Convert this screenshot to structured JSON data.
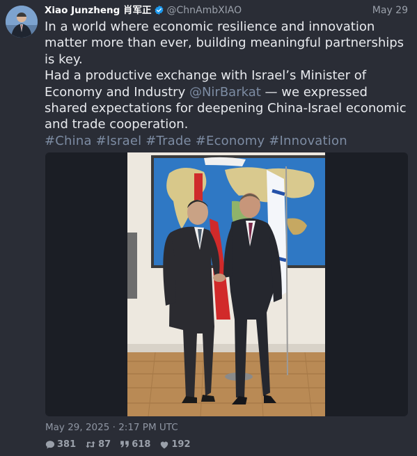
{
  "author": {
    "display_name": "Xiao Junzheng 肖军正",
    "handle": "@ChnAmbXIAO",
    "verified_icon": "verified-badge-icon"
  },
  "post": {
    "date_short": "May 29",
    "text_line1": "In a world where economic resilience and innovation matter more than ever, building meaningful partnerships is key.",
    "text_line2_before": "Had a productive exchange with Israel’s Minister of Economy and Industry ",
    "mention": "@NirBarkat",
    "text_line2_after": " — we expressed shared expectations for deepening China-Israel economic and trade cooperation.",
    "hashtags": [
      "#China",
      "#Israel",
      "#Trade",
      "#Economy",
      "#Innovation"
    ],
    "timestamp": "May 29, 2025 · 2:17 PM UTC"
  },
  "stats": {
    "replies": "381",
    "retweets": "87",
    "quotes": "618",
    "likes": "192"
  },
  "colors": {
    "background": "#2a2d36",
    "link": "#7d8ca3",
    "verified": "#1d9bf0"
  }
}
